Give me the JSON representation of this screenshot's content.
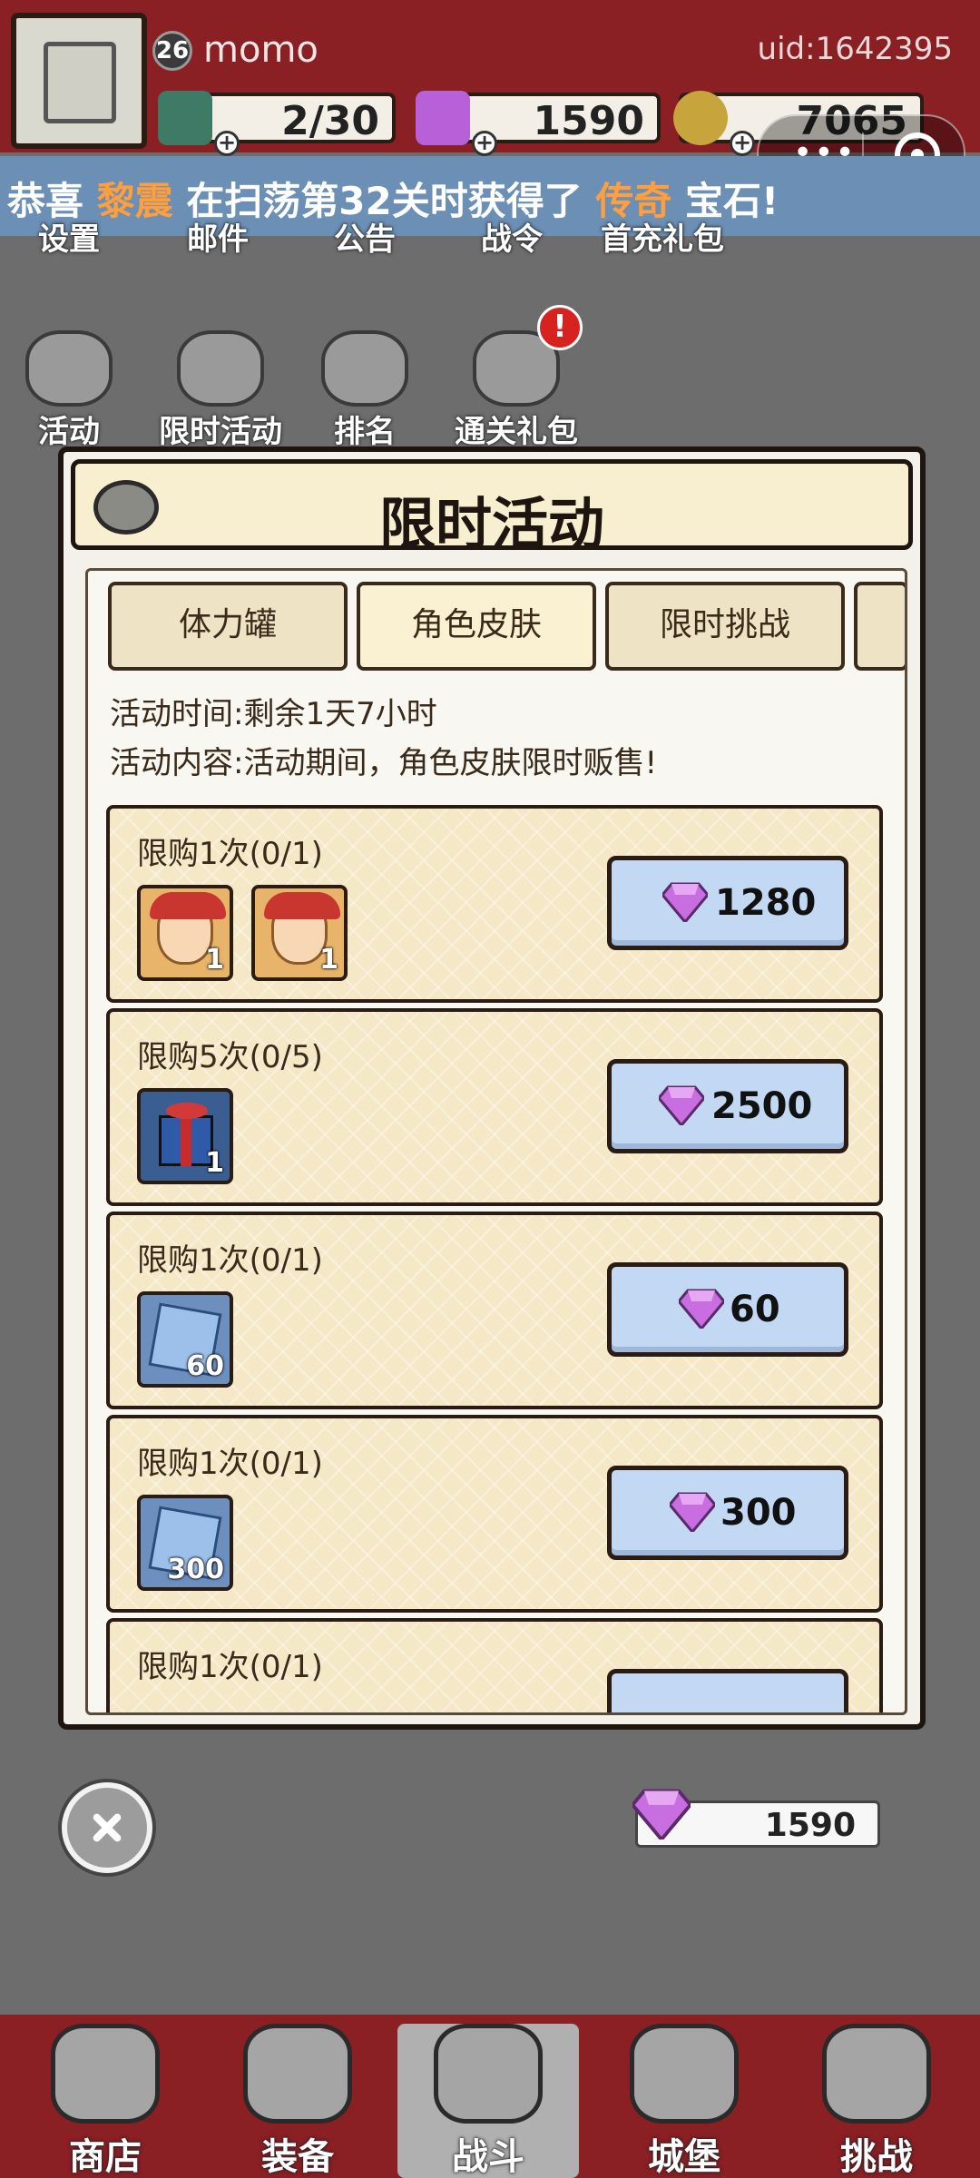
{
  "header": {
    "level": "26",
    "player_name": "momo",
    "uid": "uid:1642395",
    "stamina": "2/30",
    "gems": "1590",
    "coins": "7065"
  },
  "marquee": {
    "prefix": "恭喜",
    "player": "黎震",
    "middle": "在扫荡第32关时获得了",
    "rarity": "传奇",
    "suffix": "宝石!"
  },
  "menu": {
    "row1": [
      "设置",
      "邮件",
      "公告",
      "战令",
      "首充礼包"
    ],
    "row2": [
      "活动",
      "限时活动",
      "排名",
      "通关礼包"
    ],
    "badge": "!"
  },
  "modal": {
    "title": "限时活动",
    "tabs": [
      "体力罐",
      "角色皮肤",
      "限时挑战"
    ],
    "active_tab": "角色皮肤",
    "info_time": "活动时间:剩余1天7小时",
    "info_content": "活动内容:活动期间，角色皮肤限时贩售!",
    "offers": [
      {
        "limit": "限购1次(0/1)",
        "items": [
          {
            "type": "skin",
            "qty": "1"
          },
          {
            "type": "skin",
            "qty": "1"
          }
        ],
        "price": "1280"
      },
      {
        "limit": "限购5次(0/5)",
        "items": [
          {
            "type": "gift",
            "qty": "1"
          }
        ],
        "price": "2500"
      },
      {
        "limit": "限购1次(0/1)",
        "items": [
          {
            "type": "crystal",
            "qty": "60"
          }
        ],
        "price": "60"
      },
      {
        "limit": "限购1次(0/1)",
        "items": [
          {
            "type": "crystal",
            "qty": "300"
          }
        ],
        "price": "300"
      },
      {
        "limit": "限购1次(0/1)",
        "items": [],
        "price": ""
      }
    ]
  },
  "footer": {
    "gem_balance": "1590"
  },
  "nav": [
    "商店",
    "装备",
    "战斗",
    "城堡",
    "挑战"
  ],
  "active_nav": "战斗",
  "colors": {
    "header_red": "#8a1f24",
    "buy_button": "#c3d8f2",
    "gem_purple": "#b860d8",
    "marquee_highlight": "#ff9e3d"
  }
}
